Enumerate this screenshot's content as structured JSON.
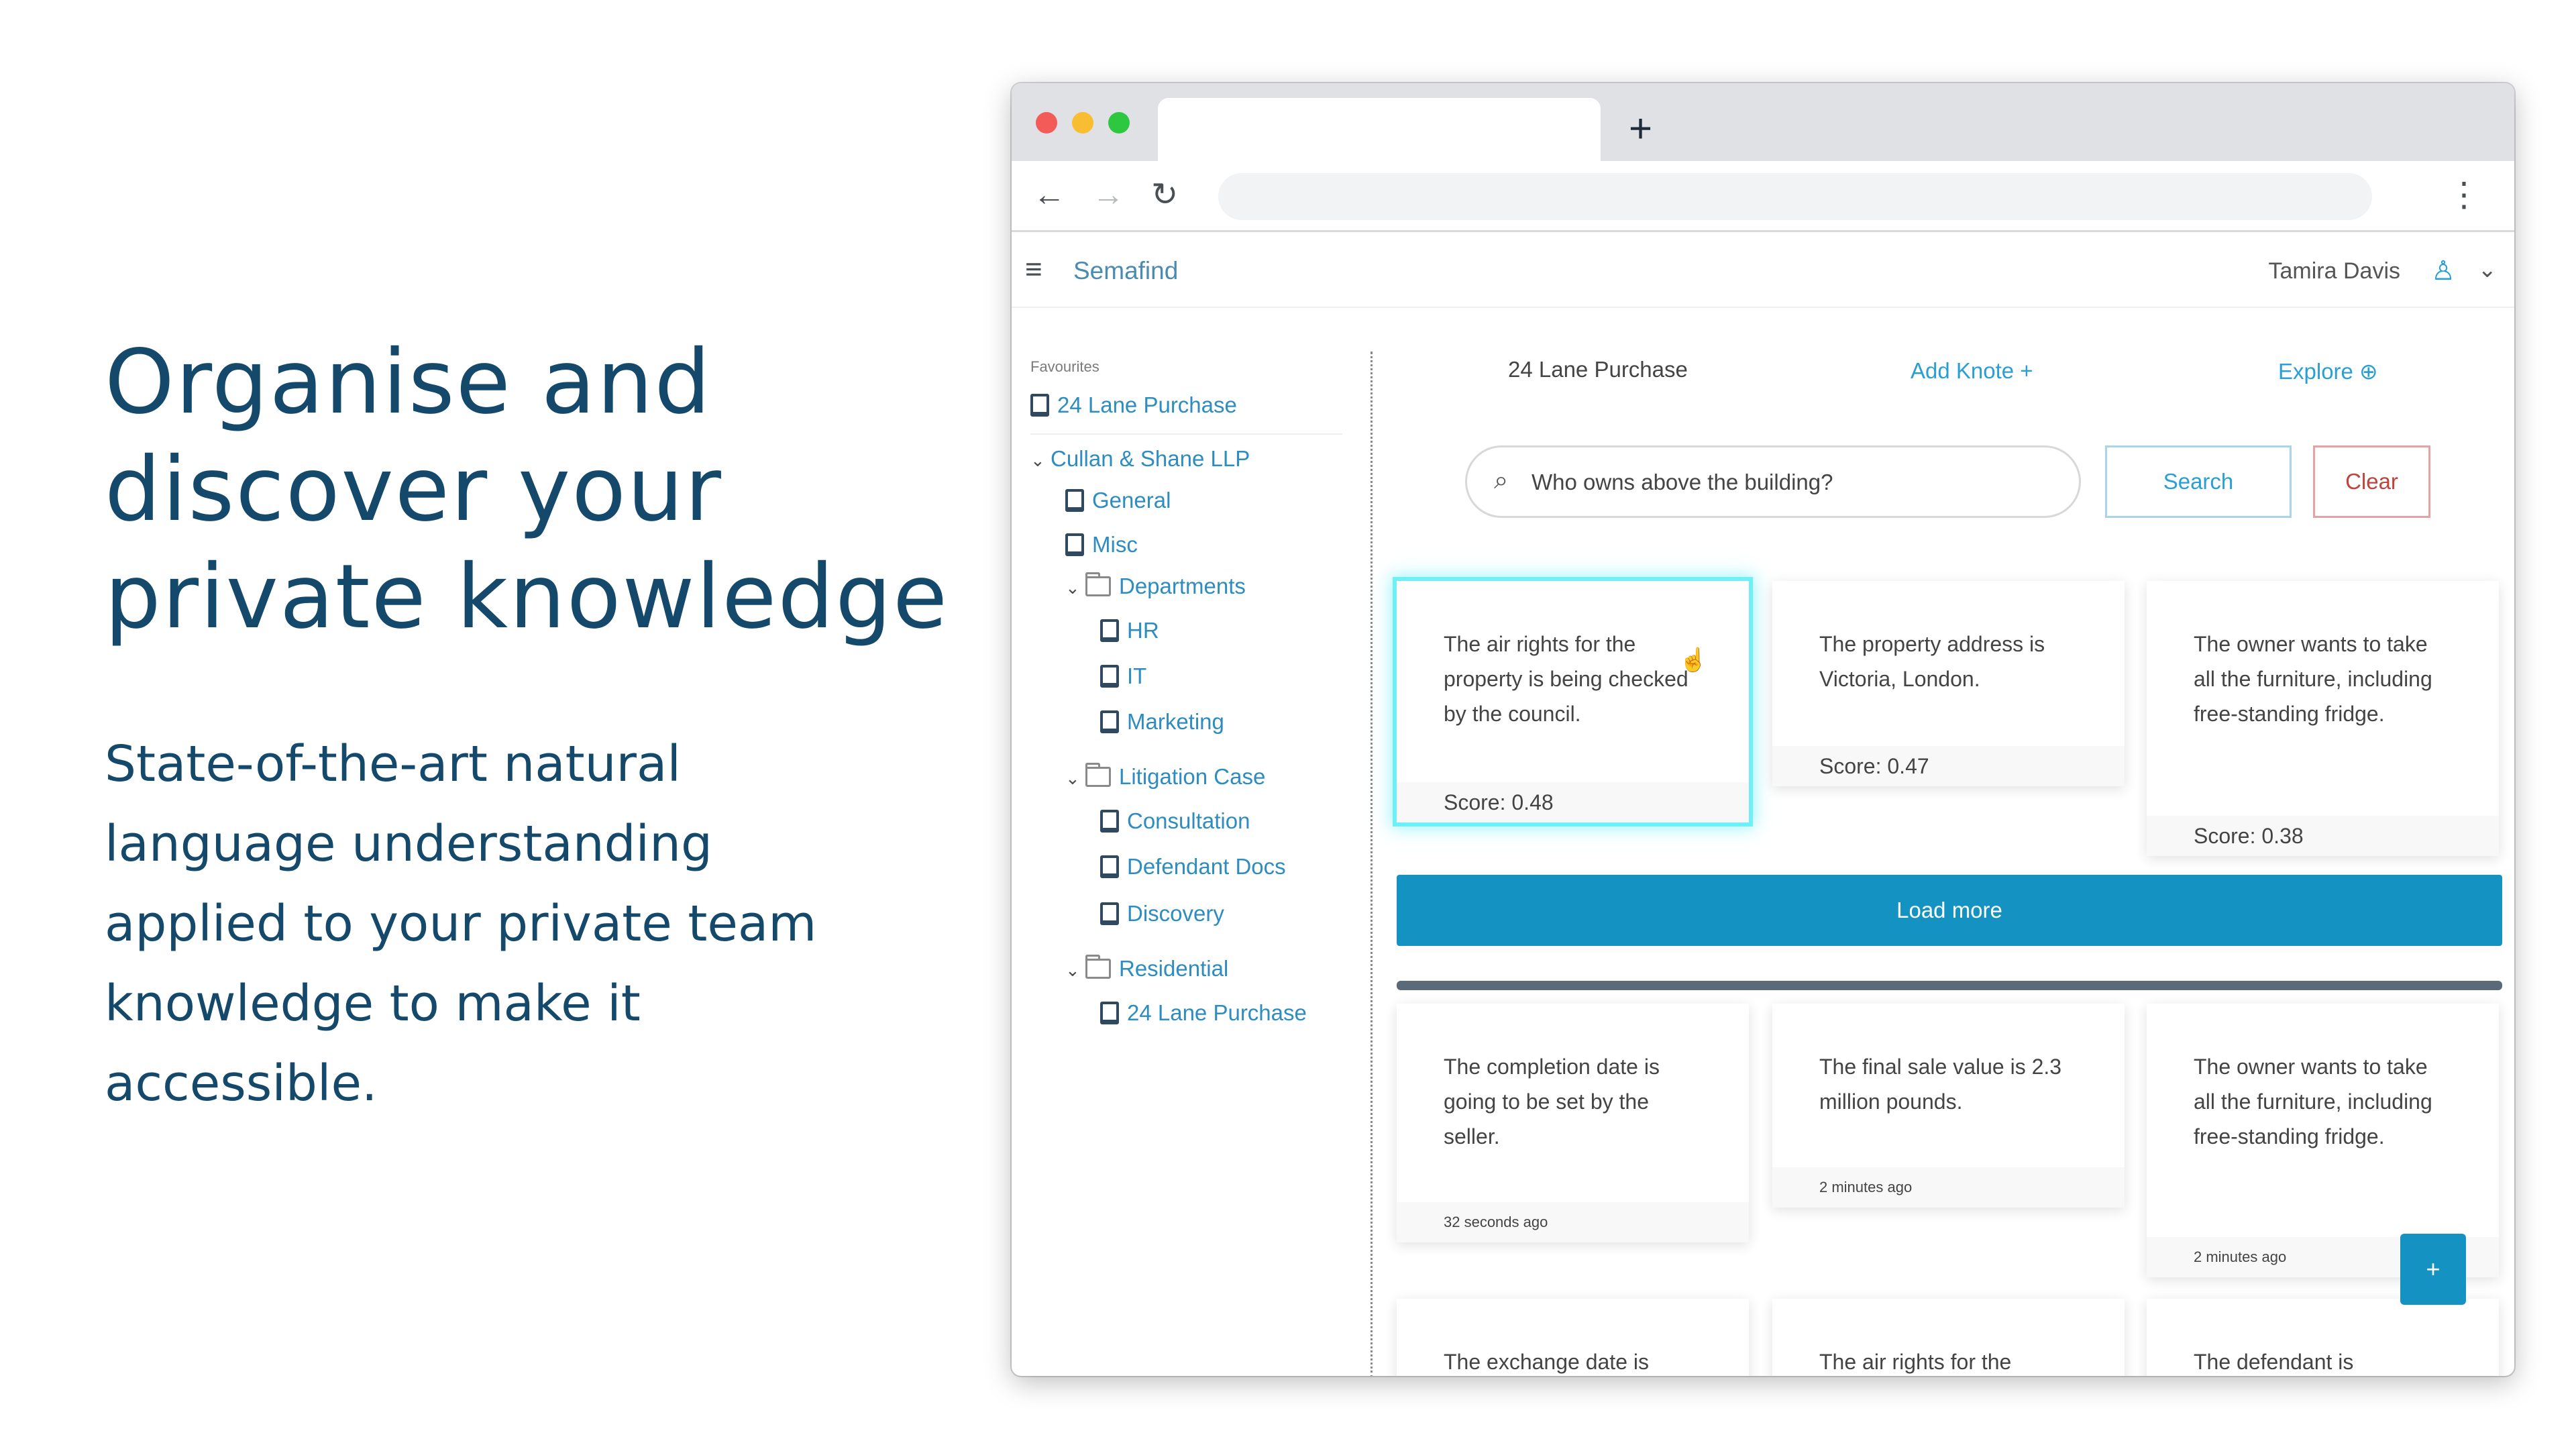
{
  "hero": {
    "title": "Organise and discover your private knowledge",
    "subtitle": "State-of-the-art natural language understanding applied to your private team knowledge to make it accessible."
  },
  "browser": {
    "new_tab": "+",
    "back": "←",
    "forward": "→",
    "reload": "↻",
    "menu": "⋮"
  },
  "app": {
    "menu_icon": "≡",
    "brand": "Semafind",
    "user_name": "Tamira Davis",
    "user_icon": "♙",
    "user_chevron": "⌄"
  },
  "sidebar": {
    "favourites_label": "Favourites",
    "favourites": [
      {
        "label": "24 Lane Purchase",
        "type": "notebook"
      }
    ],
    "tree": [
      {
        "label": "Cullan & Shane LLP",
        "type": "org",
        "expanded": true,
        "chevron": "⌄"
      },
      {
        "label": "General",
        "type": "notebook"
      },
      {
        "label": "Misc",
        "type": "notebook"
      },
      {
        "label": "Departments",
        "type": "folder",
        "expanded": true,
        "chevron": "⌄"
      },
      {
        "label": "HR",
        "type": "notebook"
      },
      {
        "label": "IT",
        "type": "notebook"
      },
      {
        "label": "Marketing",
        "type": "notebook"
      },
      {
        "label": "Litigation Case",
        "type": "folder",
        "expanded": true,
        "chevron": "⌄"
      },
      {
        "label": "Consultation",
        "type": "notebook"
      },
      {
        "label": "Defendant Docs",
        "type": "notebook"
      },
      {
        "label": "Discovery",
        "type": "notebook"
      },
      {
        "label": "Residential",
        "type": "folder",
        "expanded": true,
        "chevron": "⌄"
      },
      {
        "label": "24 Lane Purchase",
        "type": "notebook"
      }
    ]
  },
  "main": {
    "breadcrumb": "24 Lane Purchase",
    "add_knote": "Add Knote +",
    "explore": "Explore ⊕",
    "search": {
      "icon": "⌕",
      "value": "Who owns above the building?",
      "button": "Search",
      "clear": "Clear"
    },
    "results": [
      {
        "text": "The air rights for the property is being checked by the council.",
        "footer": "Score: 0.48",
        "active": true
      },
      {
        "text": "The property address is Victoria, London.",
        "footer": "Score: 0.47"
      },
      {
        "text": "The owner wants to take all the furniture, including free-standing fridge.",
        "footer": "Score: 0.38"
      }
    ],
    "load_more": "Load more",
    "knotes": [
      {
        "text": "The completion date is going to be set by the seller.",
        "footer": "32 seconds ago"
      },
      {
        "text": "The final sale value is 2.3 million pounds.",
        "footer": "2 minutes ago"
      },
      {
        "text": "The owner wants to take all the furniture, including free-standing fridge.",
        "footer": "2 minutes ago"
      },
      {
        "text": "The exchange date is",
        "footer": ""
      },
      {
        "text": "The air rights for the",
        "footer": ""
      },
      {
        "text": "The defendant is",
        "footer": ""
      }
    ],
    "fab": "+",
    "accent_color": "#1493c2",
    "highlight_color": "#6ff0f6"
  }
}
